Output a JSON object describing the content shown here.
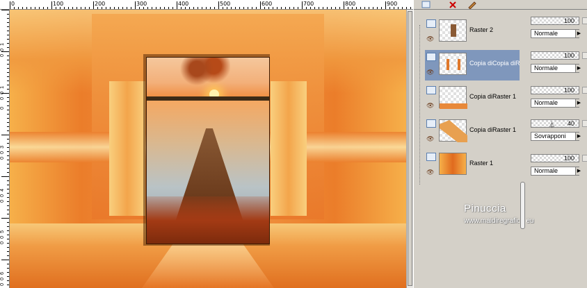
{
  "ruler": {
    "top_labels": [
      "0",
      "100",
      "200",
      "300",
      "400",
      "500",
      "600",
      "700",
      "800",
      "900"
    ],
    "left_labels": [
      "1",
      "0",
      "0",
      "1",
      "0",
      "0",
      "0",
      "3",
      "0",
      "0",
      "4",
      "0",
      "0",
      "5",
      "0",
      "0",
      "6",
      "0",
      "0"
    ]
  },
  "layers": [
    {
      "name": "Raster 2",
      "visible": true,
      "selected": false,
      "opacity": "100",
      "blend": "Normale"
    },
    {
      "name": "Copia diCopia diR",
      "visible": true,
      "selected": true,
      "opacity": "100",
      "blend": "Normale"
    },
    {
      "name": "Copia diRaster 1",
      "visible": true,
      "selected": false,
      "opacity": "100",
      "blend": "Normale"
    },
    {
      "name": "Copia diRaster 1",
      "visible": true,
      "selected": false,
      "opacity": "40",
      "blend": "Sovrapponi"
    },
    {
      "name": "Raster 1",
      "visible": true,
      "selected": false,
      "opacity": "100",
      "blend": "Normale"
    }
  ],
  "watermark": {
    "line1": "Pinuccia",
    "line2": "www.maidiregrafica.eu"
  },
  "icons": {
    "eye": "eye-icon",
    "new_layer": "new-layer-icon",
    "delete": "delete-layer-icon",
    "properties": "layer-properties-icon"
  },
  "colors": {
    "selection": "#7f97bc",
    "panel_bg": "#d4d0c8"
  }
}
